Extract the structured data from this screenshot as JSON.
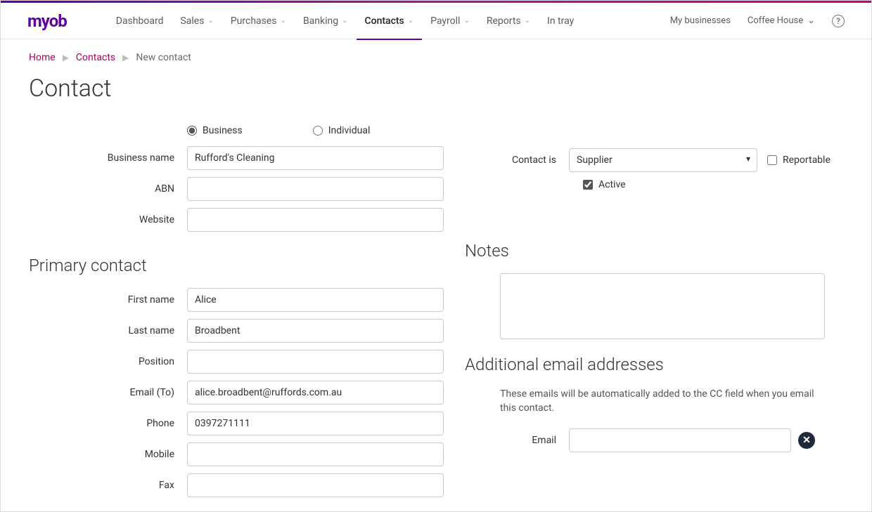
{
  "brand": "myob",
  "nav": {
    "items": [
      {
        "label": "Dashboard",
        "dropdown": false
      },
      {
        "label": "Sales",
        "dropdown": true
      },
      {
        "label": "Purchases",
        "dropdown": true
      },
      {
        "label": "Banking",
        "dropdown": true
      },
      {
        "label": "Contacts",
        "dropdown": true,
        "active": true
      },
      {
        "label": "Payroll",
        "dropdown": true
      },
      {
        "label": "Reports",
        "dropdown": true
      },
      {
        "label": "In tray",
        "dropdown": false
      }
    ],
    "right": {
      "my_businesses": "My businesses",
      "company": "Coffee House"
    }
  },
  "breadcrumb": {
    "home": "Home",
    "contacts": "Contacts",
    "current": "New contact"
  },
  "page_title": "Contact",
  "type_options": {
    "business": "Business",
    "individual": "Individual",
    "selected": "business"
  },
  "labels": {
    "business_name": "Business name",
    "abn": "ABN",
    "website": "Website",
    "contact_is": "Contact is",
    "reportable": "Reportable",
    "active": "Active",
    "first_name": "First name",
    "last_name": "Last name",
    "position": "Position",
    "email_to": "Email (To)",
    "phone": "Phone",
    "mobile": "Mobile",
    "fax": "Fax",
    "email": "Email"
  },
  "sections": {
    "primary_contact": "Primary contact",
    "notes": "Notes",
    "additional_emails": "Additional email addresses"
  },
  "values": {
    "business_name": "Rufford's Cleaning",
    "abn": "",
    "website": "",
    "contact_is": "Supplier",
    "reportable": false,
    "active": true,
    "first_name": "Alice",
    "last_name": "Broadbent",
    "position": "",
    "email_to": "alice.broadbent@ruffords.com.au",
    "phone": "0397271111",
    "mobile": "",
    "fax": "",
    "notes": "",
    "additional_email": ""
  },
  "additional_emails_hint": "These emails will be automatically added to the CC field when you email this contact."
}
